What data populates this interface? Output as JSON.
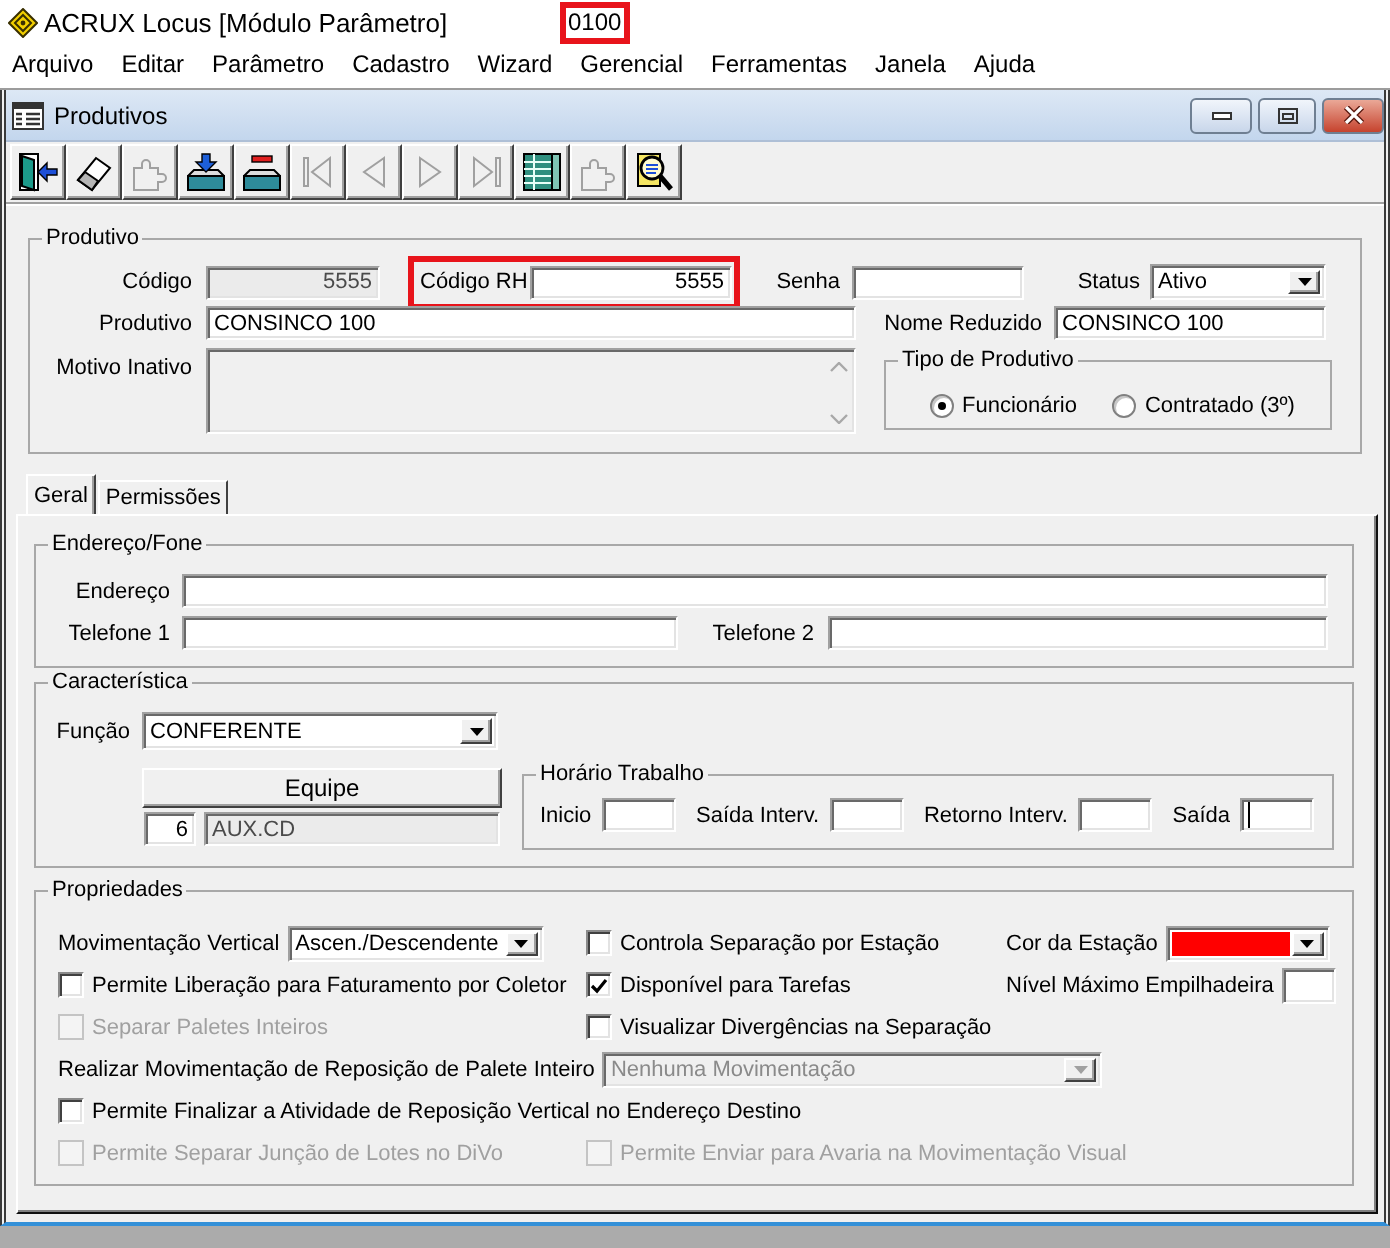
{
  "app": {
    "title": "ACRUX Locus [Módulo Parâmetro]",
    "code": "0100"
  },
  "menu": [
    "Arquivo",
    "Editar",
    "Parâmetro",
    "Cadastro",
    "Wizard",
    "Gerencial",
    "Ferramentas",
    "Janela",
    "Ajuda"
  ],
  "window": {
    "title": "Produtivos"
  },
  "toolbar": [
    {
      "kind": "exit",
      "disabled": false
    },
    {
      "kind": "eraser",
      "disabled": false
    },
    {
      "kind": "puzzle",
      "disabled": true
    },
    {
      "kind": "tray_arrow",
      "disabled": false
    },
    {
      "kind": "tray_minus",
      "disabled": false
    },
    {
      "kind": "first",
      "disabled": true
    },
    {
      "kind": "prev",
      "disabled": true
    },
    {
      "kind": "next",
      "disabled": true
    },
    {
      "kind": "last",
      "disabled": true
    },
    {
      "kind": "table",
      "disabled": false
    },
    {
      "kind": "puzzle",
      "disabled": true
    },
    {
      "kind": "search",
      "disabled": false
    }
  ],
  "produtivo": {
    "title": "Produtivo",
    "codigo": {
      "label": "Código",
      "value": "5555",
      "disabled": true
    },
    "codigo_rh": {
      "label": "Código RH",
      "value": "5555"
    },
    "senha": {
      "label": "Senha"
    },
    "status": {
      "label": "Status",
      "value": "Ativo"
    },
    "nome": {
      "label": "Produtivo",
      "value": "CONSINCO 100"
    },
    "nome_reduzido": {
      "label": "Nome Reduzido",
      "value": "CONSINCO 100"
    },
    "motivo_inativo": {
      "label": "Motivo Inativo",
      "disabled": true
    },
    "tipo": {
      "title": "Tipo de Produtivo",
      "options": [
        {
          "label": "Funcionário",
          "selected": true
        },
        {
          "label": "Contratado (3º)",
          "selected": false
        }
      ]
    }
  },
  "tabs": [
    {
      "label": "Geral",
      "selected": true
    },
    {
      "label": "Permissões",
      "selected": false
    }
  ],
  "endereco_fone": {
    "title": "Endereço/Fone",
    "endereco": {
      "label": "Endereço"
    },
    "telefone_1": {
      "label": "Telefone 1"
    },
    "telefone_2": {
      "label": "Telefone 2"
    }
  },
  "caracteristica": {
    "title": "Característica",
    "funcao": {
      "label": "Função",
      "value": "CONFERENTE"
    },
    "equipe": {
      "button": "Equipe",
      "code": {
        "value": "6"
      },
      "name": {
        "value": "AUX.CD",
        "disabled": true
      }
    },
    "horario": {
      "title": "Horário Trabalho",
      "fields": [
        {
          "label": "Inicio",
          "focused": false
        },
        {
          "label": "Saída Interv.",
          "focused": false
        },
        {
          "label": "Retorno Interv.",
          "focused": false
        },
        {
          "label": "Saída",
          "focused": true
        }
      ]
    }
  },
  "propriedades": {
    "title": "Propriedades",
    "rows": [
      {
        "items": [
          {
            "kind": "select",
            "label": "Movimentação Vertical",
            "value": "Ascen./Descendente",
            "disabled": false
          },
          {
            "kind": "checkbox",
            "label": "Controla Separação por Estação",
            "checked": false,
            "disabled": false
          },
          {
            "kind": "color",
            "label": "Cor da Estação",
            "color": "#ff0000"
          }
        ]
      },
      {
        "items": [
          {
            "kind": "checkbox",
            "label": "Permite Liberação para Faturamento por Coletor",
            "checked": false,
            "disabled": false
          },
          {
            "kind": "checkbox",
            "label": "Disponível para Tarefas",
            "checked": true,
            "disabled": false
          },
          {
            "kind": "field",
            "label": "Nível Máximo Empilhadeira"
          }
        ]
      },
      {
        "items": [
          {
            "kind": "checkbox",
            "label": "Separar Paletes Inteiros",
            "checked": false,
            "disabled": true
          },
          {
            "kind": "checkbox",
            "label": "Visualizar Divergências na Separação",
            "checked": false,
            "disabled": false
          }
        ]
      },
      {
        "items": [
          {
            "kind": "select",
            "label": "Realizar Movimentação de Reposição de Palete Inteiro",
            "value": "Nenhuma Movimentação",
            "disabled": true
          }
        ]
      },
      {
        "items": [
          {
            "kind": "checkbox",
            "label": "Permite Finalizar a Atividade de Reposição Vertical no Endereço Destino",
            "checked": false,
            "disabled": false
          }
        ]
      },
      {
        "items": [
          {
            "kind": "checkbox",
            "label": "Permite Separar Junção de Lotes no DiVo",
            "checked": false,
            "disabled": true
          },
          {
            "kind": "checkbox",
            "label": "Permite Enviar para Avaria na Movimentação Visual",
            "checked": false,
            "disabled": true
          }
        ]
      }
    ]
  }
}
